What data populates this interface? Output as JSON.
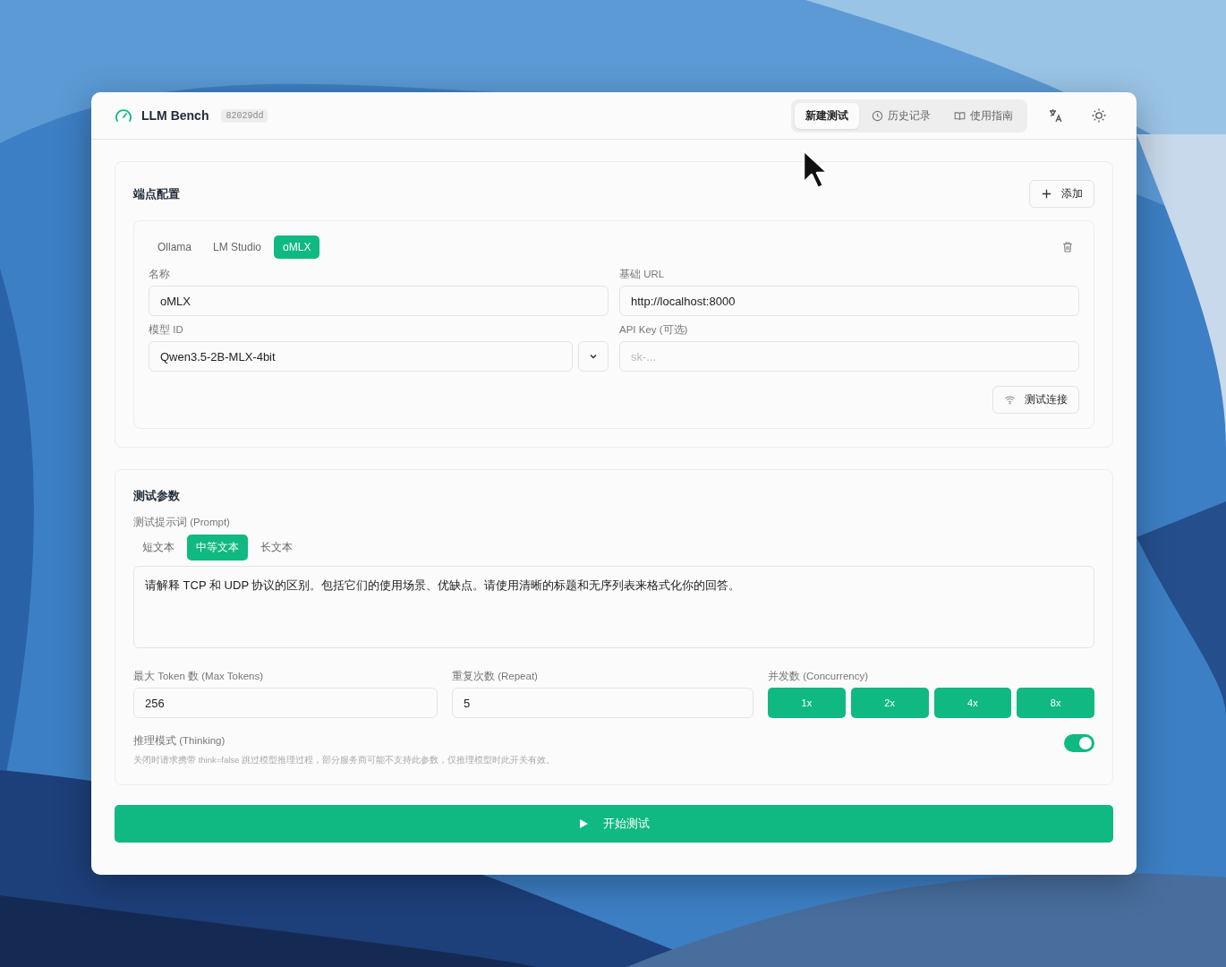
{
  "app": {
    "title": "LLM Bench",
    "version": "82029dd"
  },
  "nav": [
    {
      "label": "新建测试",
      "selected": true
    },
    {
      "label": "历史记录",
      "kind": "clock",
      "selected": false
    },
    {
      "label": "使用指南",
      "kind": "book",
      "selected": false
    }
  ],
  "endpoints": {
    "title": "端点配置",
    "add_button": "添加",
    "tabs": [
      {
        "label": "Ollama",
        "selected": false
      },
      {
        "label": "LM Studio",
        "selected": false
      },
      {
        "label": "oMLX",
        "selected": true
      }
    ],
    "name": {
      "label": "名称",
      "value": "oMLX"
    },
    "base_url": {
      "label": "基础 URL",
      "value": "http://localhost:8000"
    },
    "model_id": {
      "label": "模型 ID",
      "value": "Qwen3.5-2B-MLX-4bit"
    },
    "api_key": {
      "label": "API Key (可选)",
      "placeholder": "sk-..."
    },
    "test_button": "测试连接"
  },
  "params": {
    "title": "测试参数",
    "prompt_label": "测试提示词 (Prompt)",
    "presets": [
      {
        "label": "短文本",
        "selected": false
      },
      {
        "label": "中等文本",
        "selected": true
      },
      {
        "label": "长文本",
        "selected": false
      }
    ],
    "prompt": "请解释 TCP 和 UDP 协议的区别。包括它们的使用场景、优缺点。请使用清晰的标题和无序列表来格式化你的回答。",
    "max_tokens": {
      "label": "最大 Token 数 (Max Tokens)",
      "value": "256"
    },
    "repeat": {
      "label": "重复次数 (Repeat)",
      "value": "5"
    },
    "concurrency": {
      "label": "并发数 (Concurrency)",
      "options": [
        "1x",
        "2x",
        "4x",
        "8x"
      ]
    },
    "thinking": {
      "label": "推理模式 (Thinking)",
      "hint": "关闭时请求携带 think=false 跳过模型推理过程，部分服务商可能不支持此参数，仅推理模型时此开关有效。",
      "on": true
    }
  },
  "start_button": "开始测试"
}
